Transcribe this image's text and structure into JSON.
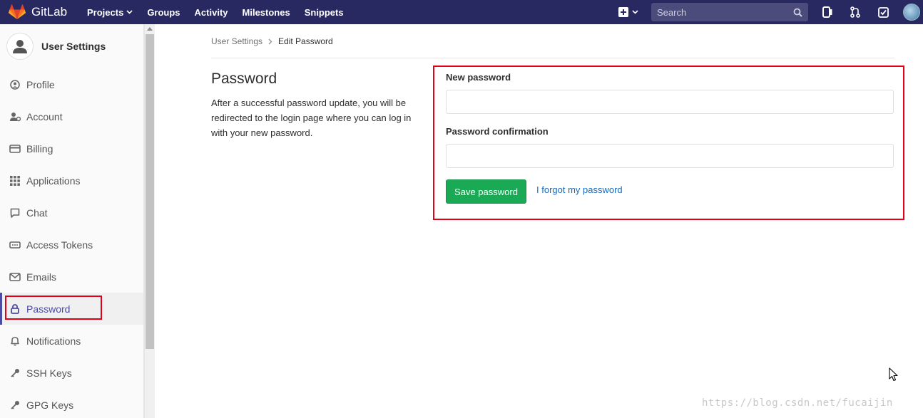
{
  "navbar": {
    "brand": "GitLab",
    "links": [
      {
        "label": "Projects",
        "has_caret": true
      },
      {
        "label": "Groups"
      },
      {
        "label": "Activity"
      },
      {
        "label": "Milestones"
      },
      {
        "label": "Snippets"
      }
    ],
    "search_placeholder": "Search",
    "icons": [
      "plus-square-icon",
      "search-icon",
      "issues-icon",
      "merge-request-icon",
      "todo-check-icon",
      "user-avatar-icon"
    ]
  },
  "sidebar": {
    "title": "User Settings",
    "items": [
      {
        "label": "Profile",
        "icon": "profile-icon"
      },
      {
        "label": "Account",
        "icon": "account-icon"
      },
      {
        "label": "Billing",
        "icon": "billing-card-icon"
      },
      {
        "label": "Applications",
        "icon": "applications-grid-icon"
      },
      {
        "label": "Chat",
        "icon": "chat-bubble-icon"
      },
      {
        "label": "Access Tokens",
        "icon": "access-tokens-icon"
      },
      {
        "label": "Emails",
        "icon": "envelope-icon"
      },
      {
        "label": "Password",
        "icon": "lock-icon",
        "active": true
      },
      {
        "label": "Notifications",
        "icon": "bell-icon"
      },
      {
        "label": "SSH Keys",
        "icon": "key-icon"
      },
      {
        "label": "GPG Keys",
        "icon": "key-icon"
      }
    ]
  },
  "breadcrumb": {
    "parent": "User Settings",
    "current": "Edit Password"
  },
  "section": {
    "title": "Password",
    "description": "After a successful password update, you will be redirected to the login page where you can log in with your new password."
  },
  "form": {
    "new_password_label": "New password",
    "new_password_value": "",
    "confirm_label": "Password confirmation",
    "confirm_value": "",
    "save_label": "Save password",
    "forgot_label": "I forgot my password"
  },
  "watermark": "https://blog.csdn.net/fucaijin",
  "colors": {
    "navbar": "#292961",
    "save_button": "#1aaa55",
    "link": "#1b69b6",
    "highlight_box": "#e2001a"
  }
}
